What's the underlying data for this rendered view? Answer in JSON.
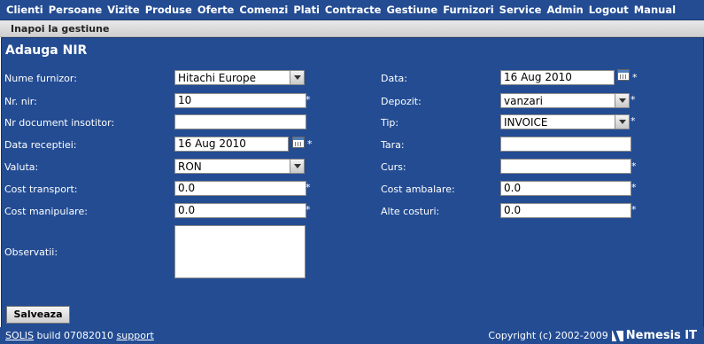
{
  "nav": [
    "Clienti",
    "Persoane",
    "Vizite",
    "Produse",
    "Oferte",
    "Comenzi",
    "Plati",
    "Contracte",
    "Gestiune",
    "Furnizori",
    "Service",
    "Admin",
    "Logout",
    "Manual"
  ],
  "subnav": {
    "back": "Inapoi la gestiune"
  },
  "form": {
    "title": "Adauga NIR",
    "required_mark": "*",
    "left": {
      "furnizor": {
        "label": "Nume furnizor:",
        "value": "Hitachi Europe"
      },
      "nr_nir": {
        "label": "Nr. nir:",
        "value": "10"
      },
      "nr_doc": {
        "label": "Nr document insotitor:",
        "value": ""
      },
      "data_receptiei": {
        "label": "Data receptiei:",
        "value": "16 Aug 2010"
      },
      "valuta": {
        "label": "Valuta:",
        "value": "RON"
      },
      "cost_transport": {
        "label": "Cost transport:",
        "value": "0.0"
      },
      "cost_manipulare": {
        "label": "Cost manipulare:",
        "value": "0.0"
      },
      "observatii": {
        "label": "Observatii:",
        "value": ""
      }
    },
    "right": {
      "data": {
        "label": "Data:",
        "value": "16 Aug 2010"
      },
      "depozit": {
        "label": "Depozit:",
        "value": "vanzari"
      },
      "tip": {
        "label": "Tip:",
        "value": "INVOICE"
      },
      "tara": {
        "label": "Tara:",
        "value": ""
      },
      "curs": {
        "label": "Curs:",
        "value": ""
      },
      "cost_ambalare": {
        "label": "Cost ambalare:",
        "value": "0.0"
      },
      "alte_costuri": {
        "label": "Alte costuri:",
        "value": "0.0"
      }
    },
    "submit": "Salveaza"
  },
  "footer": {
    "product": "SOLIS",
    "build": "build 07082010",
    "support": "support",
    "copyright": "Copyright (c) 2002-2009",
    "brand": "Nemesis IT"
  }
}
